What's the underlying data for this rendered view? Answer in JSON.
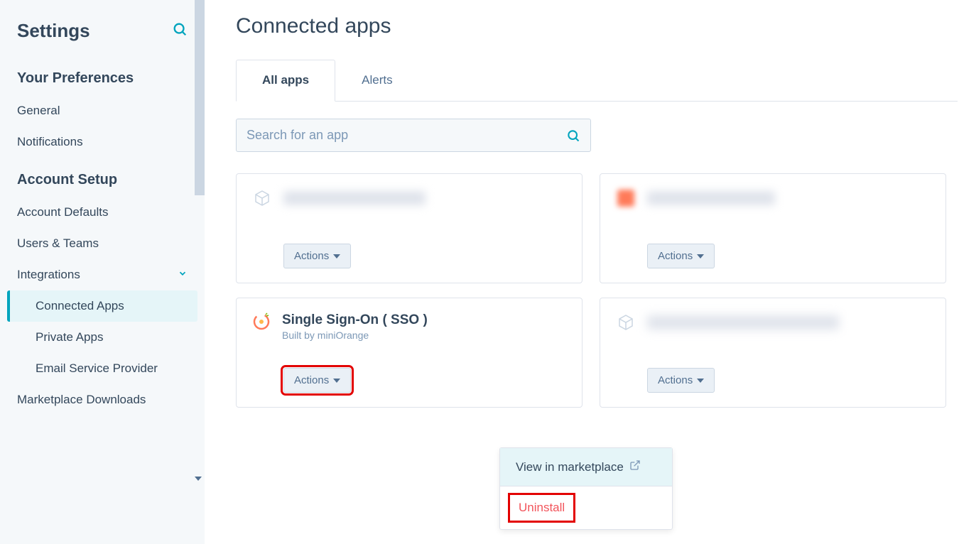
{
  "sidebar": {
    "title": "Settings",
    "sections": {
      "preferences": {
        "title": "Your Preferences",
        "items": [
          "General",
          "Notifications"
        ]
      },
      "account": {
        "title": "Account Setup",
        "items": [
          "Account Defaults",
          "Users & Teams"
        ],
        "integrations_label": "Integrations",
        "integrations_items": [
          "Connected Apps",
          "Private Apps",
          "Email Service Provider"
        ],
        "marketplace": "Marketplace Downloads"
      }
    }
  },
  "main": {
    "title": "Connected apps",
    "tabs": [
      "All apps",
      "Alerts"
    ],
    "search_placeholder": "Search for an app",
    "cards": {
      "actions_label": "Actions",
      "sso": {
        "title": "Single Sign-On ( SSO )",
        "subtitle": "Built by miniOrange"
      }
    },
    "dropdown": {
      "view": "View in marketplace",
      "uninstall": "Uninstall"
    }
  }
}
